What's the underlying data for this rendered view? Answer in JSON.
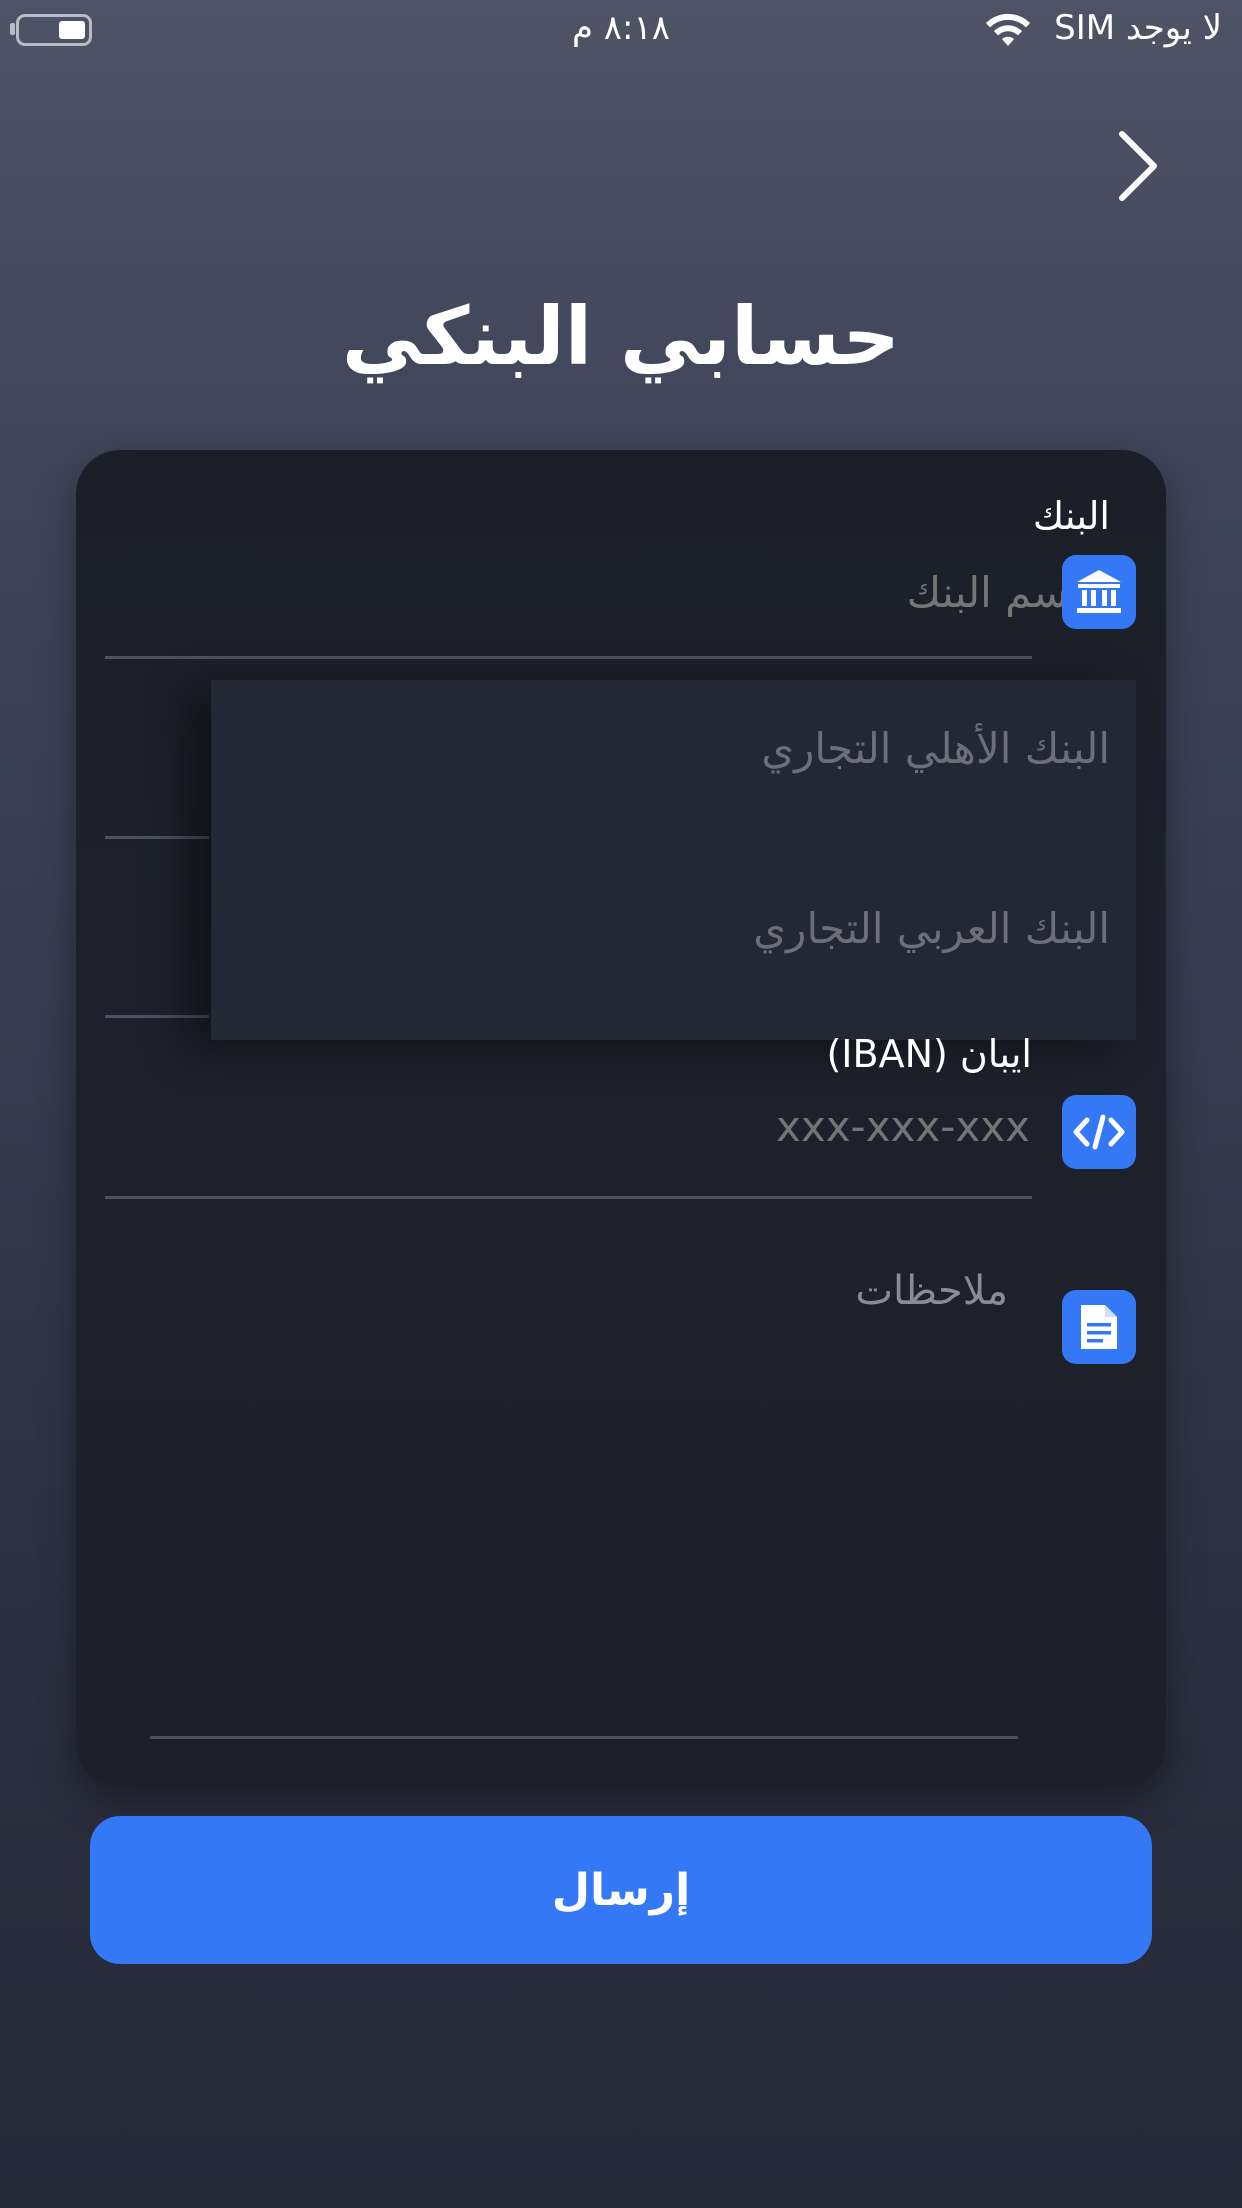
{
  "status_bar": {
    "carrier": "لا يوجد SIM",
    "time": "٨:١٨ م",
    "battery_level": 0.4
  },
  "header": {
    "back_icon": "chevron-right-icon",
    "title": "حسابي البنكي"
  },
  "form": {
    "bank": {
      "label": "البنك",
      "placeholder": "إسم البنك",
      "icon": "bank-icon",
      "options": [
        "البنك الأهلي التجاري",
        "البنك العربي التجاري"
      ]
    },
    "iban": {
      "label": "ايبان (IBAN)",
      "placeholder": "xxx-xxx-xxx",
      "icon": "code-icon"
    },
    "notes": {
      "placeholder": "ملاحظات",
      "icon": "document-icon"
    }
  },
  "submit": {
    "label": "إرسال"
  },
  "colors": {
    "accent": "#3478f6",
    "card": "#1e212b",
    "placeholder": "#8a8c93"
  }
}
